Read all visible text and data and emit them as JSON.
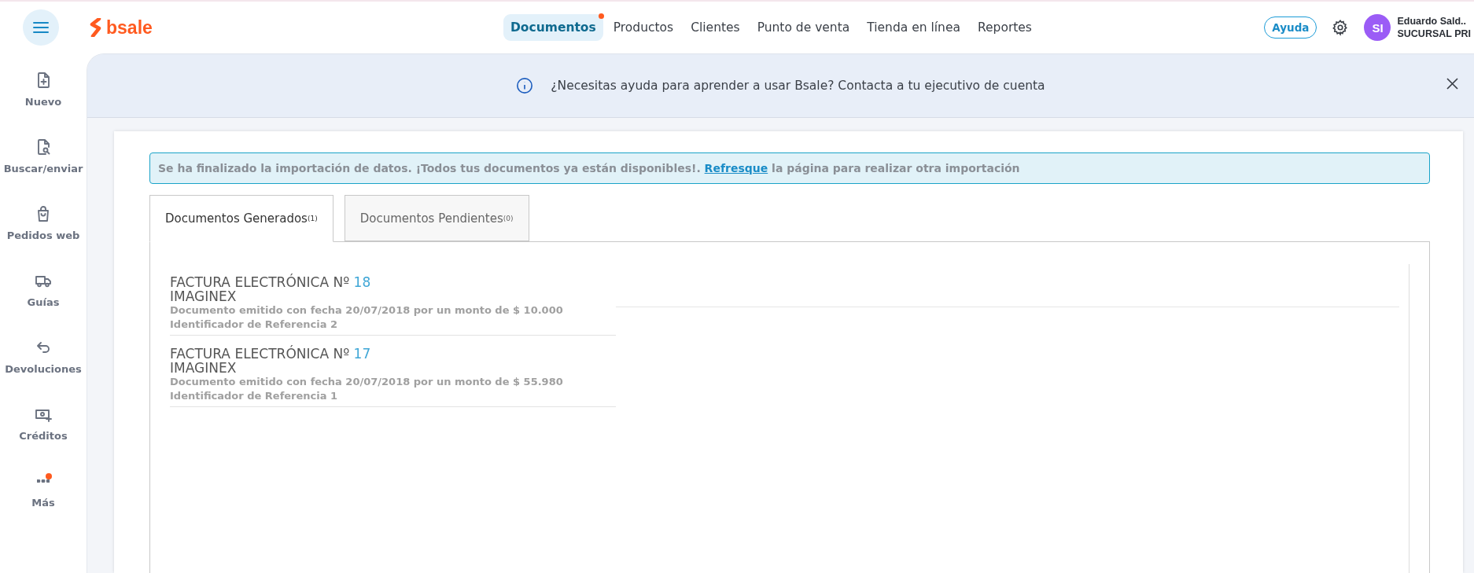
{
  "header": {
    "logo": "bsale",
    "nav": [
      {
        "label": "Documentos",
        "selected": true,
        "dot": true
      },
      {
        "label": "Productos",
        "selected": false,
        "dot": false
      },
      {
        "label": "Clientes",
        "selected": false,
        "dot": false
      },
      {
        "label": "Punto de venta",
        "selected": false,
        "dot": false
      },
      {
        "label": "Tienda en línea",
        "selected": false,
        "dot": false
      },
      {
        "label": "Reportes",
        "selected": false,
        "dot": false
      }
    ],
    "help_button": "Ayuda",
    "user": {
      "initials": "SI",
      "name": "Eduardo Sald..",
      "branch": "SUCURSAL PRI"
    }
  },
  "sidebar": {
    "items": [
      {
        "kind": "new",
        "label": "Nuevo",
        "dot": false
      },
      {
        "kind": "search",
        "label": "Buscar/enviar",
        "dot": false
      },
      {
        "kind": "bag",
        "label": "Pedidos web",
        "dot": false
      },
      {
        "kind": "truck",
        "label": "Guías",
        "dot": false
      },
      {
        "kind": "return",
        "label": "Devoluciones",
        "dot": false
      },
      {
        "kind": "credit",
        "label": "Créditos",
        "dot": false
      },
      {
        "kind": "more",
        "label": "Más",
        "dot": true
      }
    ]
  },
  "banner": {
    "text": "¿Necesitas ayuda para aprender a usar Bsale? Contacta a tu ejecutivo de cuenta"
  },
  "alert": {
    "before": "Se ha finalizado la importación de datos. ¡Todos tus documentos ya están disponibles!.",
    "link": "Refresque",
    "after": "la página para realizar otra importación"
  },
  "tabs": [
    {
      "label": "Documentos Generados",
      "count": "(1)",
      "selected": true
    },
    {
      "label": "Documentos Pendientes",
      "count": "(0)",
      "selected": false
    }
  ],
  "documents": [
    {
      "title": "FACTURA ELECTRÓNICA Nº",
      "number": "18",
      "client": "IMAGINEX",
      "detail": "Documento emitido con fecha 20/07/2018 por un monto de $ 10.000",
      "reference": "Identificador de Referencia 2"
    },
    {
      "title": "FACTURA ELECTRÓNICA Nº",
      "number": "17",
      "client": "IMAGINEX",
      "detail": "Documento emitido con fecha 20/07/2018 por un monto de $ 55.980",
      "reference": "Identificador de Referencia 1"
    }
  ]
}
